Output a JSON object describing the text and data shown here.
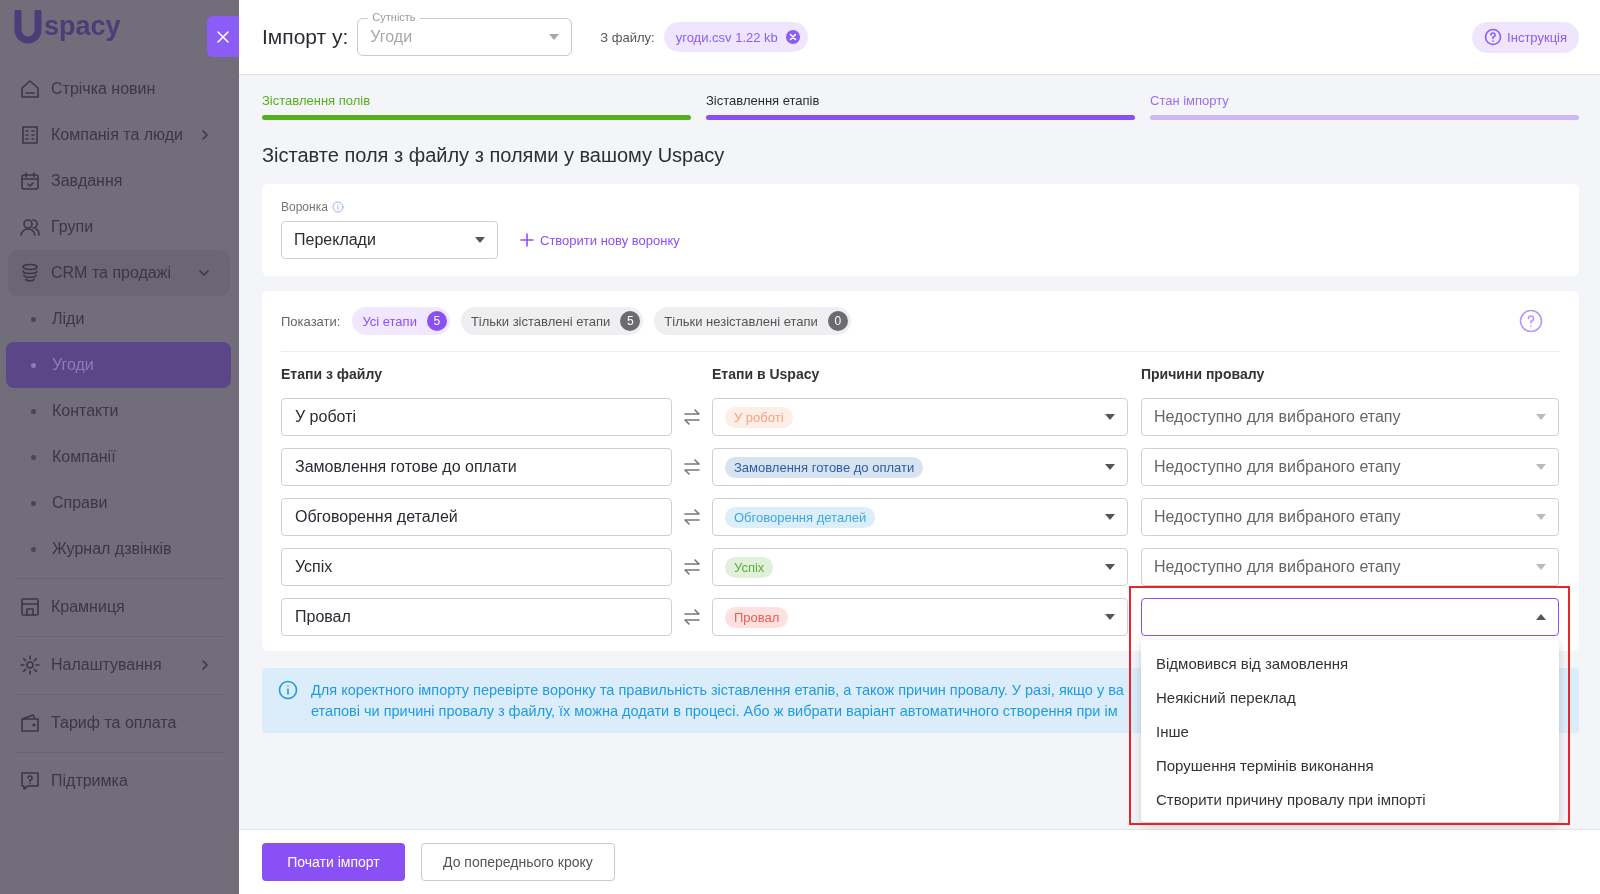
{
  "sidebar": {
    "logo": "spacy",
    "items": [
      {
        "kind": "main",
        "label": "Стрічка новин",
        "expandable": false,
        "expanded": false,
        "selected": false
      },
      {
        "kind": "main",
        "label": "Компанія та люди",
        "expandable": true,
        "expanded": false,
        "selected": false
      },
      {
        "kind": "main",
        "label": "Завдання",
        "expandable": false,
        "expanded": false,
        "selected": false
      },
      {
        "kind": "main",
        "label": "Групи",
        "expandable": false,
        "expanded": false,
        "selected": false
      },
      {
        "kind": "main",
        "label": "CRM та продажі",
        "expandable": true,
        "expanded": true,
        "selected": false
      },
      {
        "kind": "sub",
        "label": "Ліди",
        "selected": false
      },
      {
        "kind": "sub",
        "label": "Угоди",
        "selected": true
      },
      {
        "kind": "sub",
        "label": "Контакти",
        "selected": false
      },
      {
        "kind": "sub",
        "label": "Компанії",
        "selected": false
      },
      {
        "kind": "sub",
        "label": "Справи",
        "selected": false
      },
      {
        "kind": "sub",
        "label": "Журнал дзвінків",
        "selected": false
      },
      {
        "kind": "divider"
      },
      {
        "kind": "main",
        "label": "Крамниця",
        "expandable": false,
        "expanded": false,
        "selected": false
      },
      {
        "kind": "divider"
      },
      {
        "kind": "main",
        "label": "Налаштування",
        "expandable": true,
        "expanded": false,
        "selected": false
      },
      {
        "kind": "divider"
      },
      {
        "kind": "main",
        "label": "Тариф та оплата",
        "expandable": false,
        "expanded": false,
        "selected": false
      },
      {
        "kind": "divider"
      },
      {
        "kind": "main",
        "label": "Підтримка",
        "expandable": false,
        "expanded": false,
        "selected": false
      }
    ]
  },
  "header": {
    "title": "Імпорт у:",
    "entity": {
      "label": "Сутність",
      "value": "Угоди",
      "disabled": true
    },
    "file_label": "З файлу:",
    "file": "угоди.csv 1.22 kb",
    "help": "Інструкція"
  },
  "steps": [
    {
      "label": "Зіставлення полів",
      "completed": true,
      "selected": false
    },
    {
      "label": "Зіставлення етапів",
      "completed": false,
      "selected": true
    },
    {
      "label": "Стан імпорту",
      "completed": false,
      "selected": false
    }
  ],
  "heading": "Зіставте поля з файлу з полями у вашому Uspacy",
  "funnel": {
    "label": "Воронка",
    "value": "Переклади",
    "create_link": "Створити нову воронку"
  },
  "filter": {
    "label": "Показати:",
    "chips": [
      {
        "label": "Усі етапи",
        "count": "5",
        "selected": true
      },
      {
        "label": "Тільки зіставлені етапи",
        "count": "5",
        "selected": false
      },
      {
        "label": "Тільки незіставлені етапи",
        "count": "0",
        "selected": false
      }
    ]
  },
  "columns": [
    "Етапи з файлу",
    "Етапи в Uspacy",
    "Причини провалу"
  ],
  "rows": [
    {
      "file_stage": "У роботі",
      "stage": {
        "label": "У роботі",
        "color": "#f4a27e"
      },
      "reason": {
        "placeholder": "Недоступно для вибраного етапу",
        "disabled": true,
        "open": false
      }
    },
    {
      "file_stage": "Замовлення готове до оплати",
      "stage": {
        "label": "Замовлення готове до оплати",
        "color": "#2a5ea8"
      },
      "reason": {
        "placeholder": "Недоступно для вибраного етапу",
        "disabled": true,
        "open": false
      }
    },
    {
      "file_stage": "Обговорення деталей",
      "stage": {
        "label": "Обговорення деталей",
        "color": "#3fa6e0"
      },
      "reason": {
        "placeholder": "Недоступно для вибраного етапу",
        "disabled": true,
        "open": false
      }
    },
    {
      "file_stage": "Успіх",
      "stage": {
        "label": "Успіх",
        "color": "#5aae3a"
      },
      "reason": {
        "placeholder": "Недоступно для вибраного етапу",
        "disabled": true,
        "open": false
      }
    },
    {
      "file_stage": "Провал",
      "stage": {
        "label": "Провал",
        "color": "#ee5b55"
      },
      "reason": {
        "disabled": false,
        "open": true,
        "highlighted": true,
        "options": [
          "Відмовився від замовлення",
          "Неякісний переклад",
          "Інше",
          "Порушення термінів виконання",
          "Створити причину провалу при імпорті"
        ]
      }
    }
  ],
  "info": [
    "Для коректного імпорту перевірте воронку та правильність зіставлення етапів, а також причин провалу. У разі, якщо у ва",
    "етапові чи причині провалу з файлу, їх можна додати в процесі. Або ж вибрати варіант автоматичного створення при ім"
  ],
  "footer": [
    {
      "label": "Почати імпорт",
      "kind": "primary"
    },
    {
      "label": "До попереднього кроку",
      "kind": "secondary"
    }
  ]
}
